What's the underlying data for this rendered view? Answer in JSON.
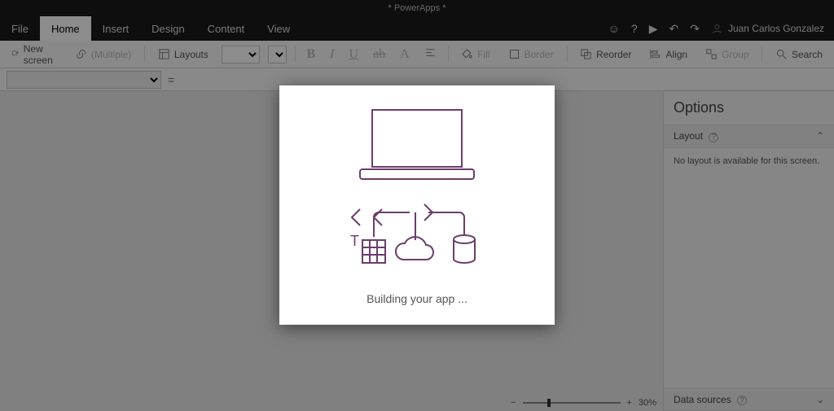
{
  "title": "* PowerApps *",
  "tabs": {
    "file": "File",
    "home": "Home",
    "insert": "Insert",
    "design": "Design",
    "content": "Content",
    "view": "View"
  },
  "user": {
    "name": "Juan Carlos Gonzalez"
  },
  "ribbon": {
    "new_screen": "New screen",
    "multiple": "(Multiple)",
    "layouts": "Layouts",
    "fill": "Fill",
    "border": "Border",
    "reorder": "Reorder",
    "align": "Align",
    "group": "Group",
    "search": "Search"
  },
  "formula": {
    "eq": "="
  },
  "options": {
    "title": "Options",
    "layout_label": "Layout",
    "no_layout": "No layout is available for this screen.",
    "data_sources": "Data sources"
  },
  "zoom": {
    "minus": "−",
    "plus": "+",
    "value": "30%"
  },
  "modal": {
    "message": "Building your app ..."
  }
}
